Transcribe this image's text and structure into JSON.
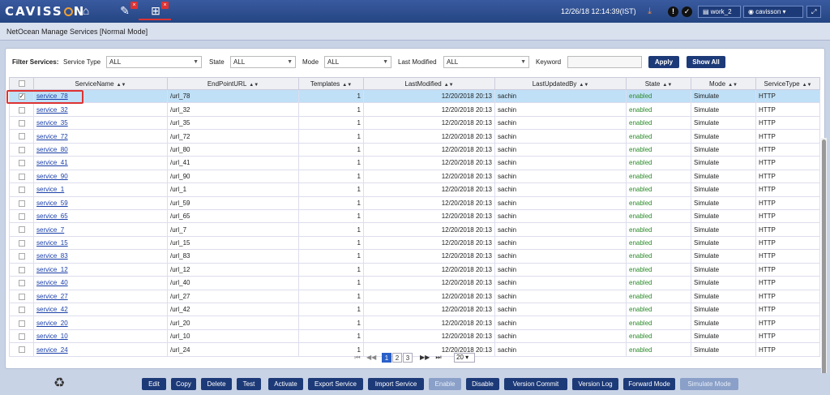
{
  "app": {
    "logo_prefix": "CAVISS",
    "logo_suffix": "N",
    "datetime": "12/26/18 12:14:39(IST)",
    "workspace": "work_2",
    "user": "cavisson"
  },
  "page_title": "NetOcean Manage Services [Normal Mode]",
  "filters": {
    "label": "Filter Services:",
    "service_type": {
      "label": "Service Type",
      "value": "ALL"
    },
    "state": {
      "label": "State",
      "value": "ALL"
    },
    "mode": {
      "label": "Mode",
      "value": "ALL"
    },
    "last_modified": {
      "label": "Last Modified",
      "value": "ALL"
    },
    "keyword": {
      "label": "Keyword",
      "value": ""
    },
    "apply_label": "Apply",
    "show_all_label": "Show All"
  },
  "table": {
    "columns": [
      "ServiceName",
      "EndPointURL",
      "Templates",
      "LastModified",
      "LastUpdatedBy",
      "State",
      "Mode",
      "ServiceType"
    ],
    "rows": [
      {
        "name": "service_78",
        "url": "/url_78",
        "templates": "1",
        "modified": "12/20/2018 20:13",
        "by": "sachin",
        "state": "enabled",
        "mode": "Simulate",
        "type": "HTTP",
        "checked": true
      },
      {
        "name": "service_32",
        "url": "/url_32",
        "templates": "1",
        "modified": "12/20/2018 20:13",
        "by": "sachin",
        "state": "enabled",
        "mode": "Simulate",
        "type": "HTTP"
      },
      {
        "name": "service_35",
        "url": "/url_35",
        "templates": "1",
        "modified": "12/20/2018 20:13",
        "by": "sachin",
        "state": "enabled",
        "mode": "Simulate",
        "type": "HTTP"
      },
      {
        "name": "service_72",
        "url": "/url_72",
        "templates": "1",
        "modified": "12/20/2018 20:13",
        "by": "sachin",
        "state": "enabled",
        "mode": "Simulate",
        "type": "HTTP"
      },
      {
        "name": "service_80",
        "url": "/url_80",
        "templates": "1",
        "modified": "12/20/2018 20:13",
        "by": "sachin",
        "state": "enabled",
        "mode": "Simulate",
        "type": "HTTP"
      },
      {
        "name": "service_41",
        "url": "/url_41",
        "templates": "1",
        "modified": "12/20/2018 20:13",
        "by": "sachin",
        "state": "enabled",
        "mode": "Simulate",
        "type": "HTTP"
      },
      {
        "name": "service_90",
        "url": "/url_90",
        "templates": "1",
        "modified": "12/20/2018 20:13",
        "by": "sachin",
        "state": "enabled",
        "mode": "Simulate",
        "type": "HTTP"
      },
      {
        "name": "service_1",
        "url": "/url_1",
        "templates": "1",
        "modified": "12/20/2018 20:13",
        "by": "sachin",
        "state": "enabled",
        "mode": "Simulate",
        "type": "HTTP"
      },
      {
        "name": "service_59",
        "url": "/url_59",
        "templates": "1",
        "modified": "12/20/2018 20:13",
        "by": "sachin",
        "state": "enabled",
        "mode": "Simulate",
        "type": "HTTP"
      },
      {
        "name": "service_65",
        "url": "/url_65",
        "templates": "1",
        "modified": "12/20/2018 20:13",
        "by": "sachin",
        "state": "enabled",
        "mode": "Simulate",
        "type": "HTTP"
      },
      {
        "name": "service_7",
        "url": "/url_7",
        "templates": "1",
        "modified": "12/20/2018 20:13",
        "by": "sachin",
        "state": "enabled",
        "mode": "Simulate",
        "type": "HTTP"
      },
      {
        "name": "service_15",
        "url": "/url_15",
        "templates": "1",
        "modified": "12/20/2018 20:13",
        "by": "sachin",
        "state": "enabled",
        "mode": "Simulate",
        "type": "HTTP"
      },
      {
        "name": "service_83",
        "url": "/url_83",
        "templates": "1",
        "modified": "12/20/2018 20:13",
        "by": "sachin",
        "state": "enabled",
        "mode": "Simulate",
        "type": "HTTP"
      },
      {
        "name": "service_12",
        "url": "/url_12",
        "templates": "1",
        "modified": "12/20/2018 20:13",
        "by": "sachin",
        "state": "enabled",
        "mode": "Simulate",
        "type": "HTTP"
      },
      {
        "name": "service_40",
        "url": "/url_40",
        "templates": "1",
        "modified": "12/20/2018 20:13",
        "by": "sachin",
        "state": "enabled",
        "mode": "Simulate",
        "type": "HTTP"
      },
      {
        "name": "service_27",
        "url": "/url_27",
        "templates": "1",
        "modified": "12/20/2018 20:13",
        "by": "sachin",
        "state": "enabled",
        "mode": "Simulate",
        "type": "HTTP"
      },
      {
        "name": "service_42",
        "url": "/url_42",
        "templates": "1",
        "modified": "12/20/2018 20:13",
        "by": "sachin",
        "state": "enabled",
        "mode": "Simulate",
        "type": "HTTP"
      },
      {
        "name": "service_20",
        "url": "/url_20",
        "templates": "1",
        "modified": "12/20/2018 20:13",
        "by": "sachin",
        "state": "enabled",
        "mode": "Simulate",
        "type": "HTTP"
      },
      {
        "name": "service_10",
        "url": "/url_10",
        "templates": "1",
        "modified": "12/20/2018 20:13",
        "by": "sachin",
        "state": "enabled",
        "mode": "Simulate",
        "type": "HTTP"
      },
      {
        "name": "service_24",
        "url": "/url_24",
        "templates": "1",
        "modified": "12/20/2018 20:13",
        "by": "sachin",
        "state": "enabled",
        "mode": "Simulate",
        "type": "HTTP"
      }
    ]
  },
  "pager": {
    "pages": [
      "1",
      "2",
      "3"
    ],
    "current": "1",
    "page_size": "20"
  },
  "actions": [
    {
      "label": "Edit"
    },
    {
      "label": "Copy"
    },
    {
      "label": "Delete"
    },
    {
      "label": "Test"
    },
    {
      "label": "Activate"
    },
    {
      "label": "Export Service"
    },
    {
      "label": "Import Service"
    },
    {
      "label": "Enable",
      "disabled": true
    },
    {
      "label": "Disable"
    },
    {
      "label": "Version Commit"
    },
    {
      "label": "Version Log"
    },
    {
      "label": "Forward Mode"
    },
    {
      "label": "Simulate Mode",
      "disabled": true
    }
  ],
  "colors": {
    "header": "#244582",
    "button": "#1d3a78",
    "enabled": "#2b8a2b",
    "selected_row": "#bfe0f7",
    "highlight": "#d33333"
  },
  "icons": {
    "home": "home-icon",
    "tools": "wrench-icon",
    "network": "network-icon",
    "alert": "alert-icon",
    "check": "check-circle-icon",
    "recycle": "recycle-icon",
    "expand": "expand-icon"
  }
}
